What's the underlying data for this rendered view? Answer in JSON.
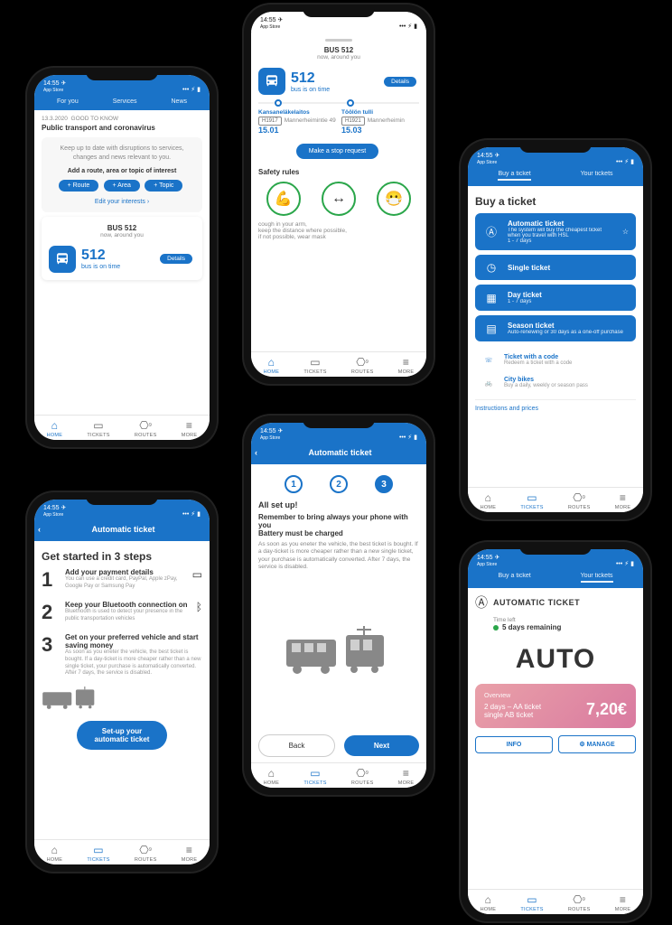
{
  "status": {
    "time": "14:55",
    "source": "App Store"
  },
  "nav": {
    "home": "HOME",
    "tickets": "TICKETS",
    "routes": "ROUTES",
    "more": "MORE",
    "routes_badge": "9"
  },
  "p1": {
    "tabs": {
      "foryou": "For you",
      "services": "Services",
      "news": "News"
    },
    "news_date": "13.3.2020",
    "news_tag": "GOOD TO KNOW",
    "news_title": "Public transport and coronavirus",
    "prompt": "Keep up to date with disruptions to services, changes and news relevant to you.",
    "add_title": "Add a route, area or topic of interest",
    "chip_route": "+  Route",
    "chip_area": "+  Area",
    "chip_topic": "+  Topic",
    "edit": "Edit your interests ›",
    "bus_title": "BUS 512",
    "bus_sub": "now, around you",
    "bus_num": "512",
    "bus_status": "bus is on time",
    "details": "Details"
  },
  "p2": {
    "bus_title": "BUS 512",
    "bus_sub": "now, around you",
    "bus_num": "512",
    "bus_status": "bus is on time",
    "details": "Details",
    "stop1_name": "Kansaneläkelaitos",
    "stop1_code": "H1917",
    "stop1_street": "Mannerheimintie 49",
    "stop1_time": "15.01",
    "stop2_name": "Töölön tulli",
    "stop2_code": "H1921",
    "stop2_street": "Mannerheimin",
    "stop2_time": "15.03",
    "stop_req": "Make a stop request",
    "safety_title": "Safety rules",
    "safety_txt": "cough in your arm,\nkeep the distance where possible,\nif not possible, wear mask"
  },
  "p3": {
    "tabs": {
      "buy": "Buy a ticket",
      "your": "Your tickets"
    },
    "title": "Buy a ticket",
    "t_auto": "Automatic ticket",
    "t_auto_sub": "The system will buy the cheapest ticket when you travel with HSL",
    "t_auto_range": "1 - 7 days",
    "t_single": "Single ticket",
    "t_day": "Day ticket",
    "t_day_sub": "1 - 7 days",
    "t_season": "Season ticket",
    "t_season_sub": "Auto-renewing or 30 days as a one-off purchase",
    "t_code": "Ticket with a code",
    "t_code_sub": "Redeem a ticket with a code",
    "t_bikes": "City bikes",
    "t_bikes_sub": "Buy a daily, weekly or season pass",
    "instructions": "Instructions and prices"
  },
  "p4": {
    "title": "Automatic ticket",
    "heading": "Get started in 3 steps",
    "s1_t": "Add your payment details",
    "s1_d": "You can use a credit card, PayPal, Apple zPay, Google Pay or Samsung Pay",
    "s2_t": "Keep your Bluetooth connection on",
    "s2_d": "Bluethooth is used to detect your presence in the public transportation vehicles",
    "s3_t": "Get on your preferred vehicle and start saving money",
    "s3_d": "As soon as you eneter the vehicle, the best ticket is bought. If a day-ticket is more cheaper rather than a new single ticket, your purchase is automatically converted. After 7 days, the service is disabled.",
    "cta": "Set-up your\nautomatic ticket"
  },
  "p5": {
    "title": "Automatic ticket",
    "heading1": "All set up!",
    "heading2": "Remember to bring always your phone with you",
    "heading3": "Battery must be charged",
    "desc": "As soon as you eneter the vehicle, the best ticket is bought. If a day-ticket is more cheaper rather than a new single ticket, your purchase is automatically converted. After 7 days, the service is disabled.",
    "back": "Back",
    "next": "Next"
  },
  "p6": {
    "tabs": {
      "buy": "Buy a ticket",
      "your": "Your tickets"
    },
    "head": "AUTOMATIC TICKET",
    "time_left_lbl": "Time left",
    "time_left": "5 days remaining",
    "big": "AUTO",
    "ov_title": "Overview",
    "ov_l1": "2 days – AA ticket",
    "ov_l2": "single AB ticket",
    "price": "7,20€",
    "info": "INFO",
    "manage": "MANAGE"
  }
}
